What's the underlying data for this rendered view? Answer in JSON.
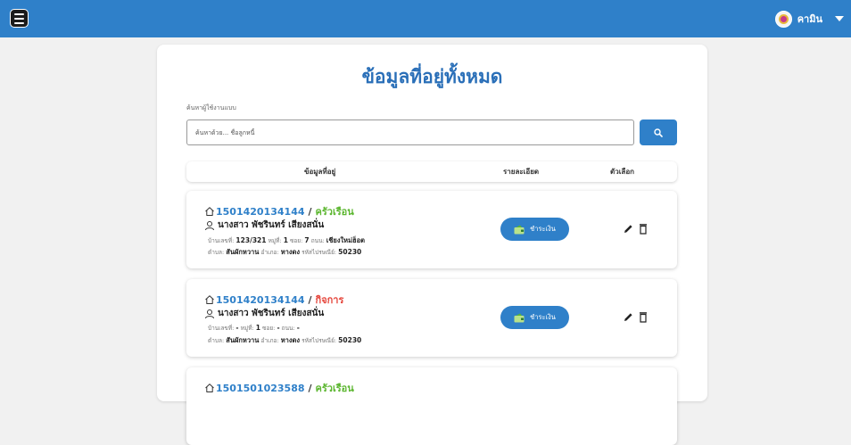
{
  "header": {
    "user_name": "คามิน"
  },
  "page": {
    "title": "ข้อมูลที่อยู่ทั้งหมด",
    "search_label": "ค้นหาผู้ใช้งานแบบ",
    "search_placeholder": "ค้นหาด้วย... ชื่อลูกหนี้"
  },
  "table": {
    "columns": [
      "ข้อมูลที่อยู่",
      "รายละเอียด",
      "ตัวเลือก"
    ]
  },
  "records": [
    {
      "code": "1501420134144",
      "separator": "/",
      "type": "ครัวเรือน",
      "name": "นางสาว พัชรินทร์ เสียงสนั่น",
      "house_label": "บ้านเลขที่:",
      "house": "123/321",
      "moo_label": "หมู่ที่:",
      "moo": "1",
      "soi_label": "ซอย:",
      "soi": "7",
      "road_label": "ถนน:",
      "road": "เชียงใหม่ฮ็อต",
      "tambon_label": "ตำบล:",
      "tambon": "สันผักหวาน",
      "amphoe_label": "อำเภอ:",
      "amphoe": "หางดง",
      "postcode_label": "รหัสไปรษณีย์:",
      "postcode": "50230",
      "pay_label": "ชำระเงิน"
    },
    {
      "code": "1501420134144",
      "separator": "/",
      "type": "กิจการ",
      "name": "นางสาว พัชรินทร์ เสียงสนั่น",
      "house_label": "บ้านเลขที่:",
      "house": "-",
      "moo_label": "หมู่ที่:",
      "moo": "1",
      "soi_label": "ซอย:",
      "soi": "-",
      "road_label": "ถนน:",
      "road": "-",
      "tambon_label": "ตำบล:",
      "tambon": "สันผักหวาน",
      "amphoe_label": "อำเภอ:",
      "amphoe": "หางดง",
      "postcode_label": "รหัสไปรษณีย์:",
      "postcode": "50230",
      "pay_label": "ชำระเงิน"
    },
    {
      "code": "1501501023588",
      "separator": "/",
      "type": "ครัวเรือน"
    }
  ],
  "icons": {
    "menu": "menu-icon",
    "avatar": "avatar",
    "caret": "chevron-down-icon",
    "search": "search-icon",
    "house": "house-icon",
    "person": "person-icon",
    "pay": "wallet-icon",
    "edit": "pencil-icon",
    "delete": "trash-icon"
  },
  "colors": {
    "primary": "#2f80c9",
    "residential": "#5cb630",
    "business": "#e5453b"
  }
}
